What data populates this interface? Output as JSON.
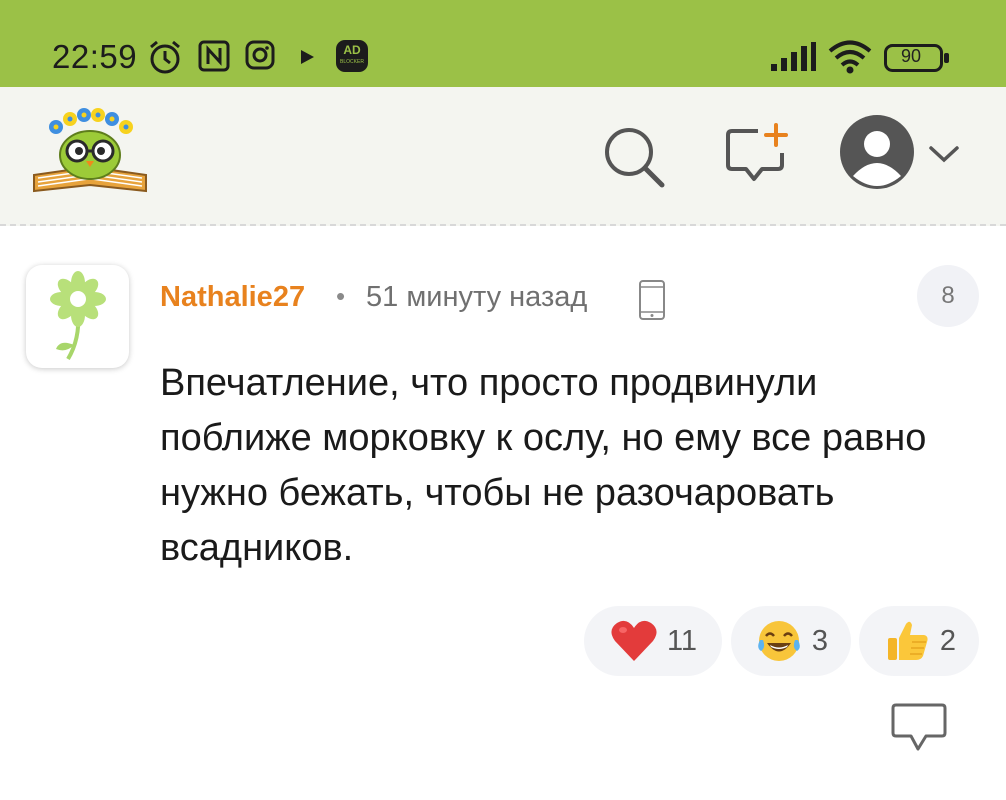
{
  "status_bar": {
    "time": "22:59",
    "battery": "90",
    "icons": [
      "alarm-icon",
      "nfc-icon",
      "instagram-icon",
      "play-icon",
      "ad-blocker-icon",
      "signal-icon",
      "wifi-icon",
      "battery-icon"
    ],
    "ad_blocker_top": "AD",
    "ad_blocker_bottom": "BLOCKER",
    "bg_color": "#9bc147"
  },
  "header": {
    "logo": "owl-reading-book-logo",
    "actions": [
      "search-icon",
      "new-post-icon",
      "profile-avatar-icon",
      "chevron-down-icon"
    ]
  },
  "comment": {
    "author": "Nathalie27",
    "separator": "•",
    "time_ago": "51 минуту назад",
    "device": "mobile-phone-icon",
    "rating": "8",
    "text": "Впечатление, что просто продвинули поближе морковку к ослу, но ему все равно нужно бежать, чтобы не разочаровать всадников.",
    "author_color": "#e8821e",
    "reactions": [
      {
        "emoji": "heart",
        "count": "11"
      },
      {
        "emoji": "tears-of-joy",
        "count": "3"
      },
      {
        "emoji": "thumbs-up",
        "count": "2"
      }
    ]
  }
}
